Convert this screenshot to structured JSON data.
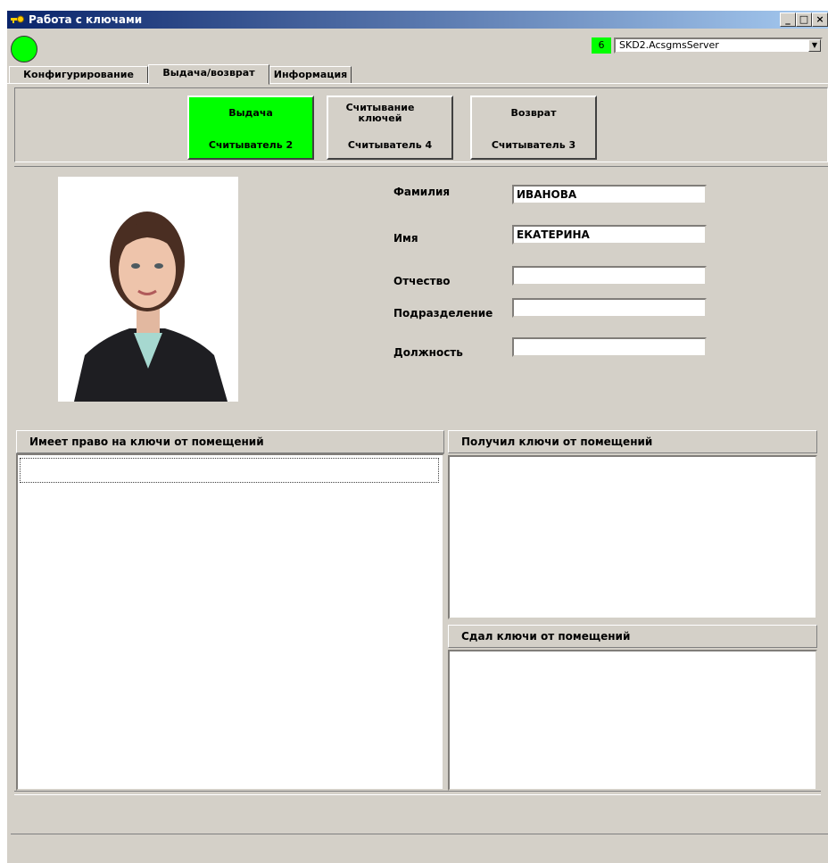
{
  "window": {
    "title": "Работа с ключами",
    "minimize": "_",
    "maximize": "□",
    "close": "×"
  },
  "server": {
    "count": "6",
    "name": "SKD2.AcsgmsServer"
  },
  "tabs": [
    {
      "label": "Конфигурирование",
      "active": false
    },
    {
      "label": "Выдача/возврат",
      "active": true
    },
    {
      "label": "Информация",
      "active": false
    }
  ],
  "readers": [
    {
      "line1": "Выдача",
      "line2": "Считыватель 2",
      "active": true
    },
    {
      "line1": "Считывание ключей",
      "line2": "Считыватель 4",
      "active": false
    },
    {
      "line1": "Возврат",
      "line2": "Считыватель 3",
      "active": false
    }
  ],
  "person": {
    "surname_label": "Фамилия",
    "surname": "ИВАНОВА",
    "name_label": "Имя",
    "name": "ЕКАТЕРИНА",
    "patronymic_label": "Отчество",
    "patronymic": "",
    "department_label": "Подразделение",
    "department": "",
    "position_label": "Должность",
    "position": ""
  },
  "panels": {
    "rights": "Имеет право на  ключи от помещений",
    "received": "Получил  ключи от помещений",
    "returned": "Сдал ключи от помещений"
  },
  "colors": {
    "active_green": "#00ff00",
    "window_bg": "#d4d0c8",
    "title_bar": "#0a246a"
  }
}
